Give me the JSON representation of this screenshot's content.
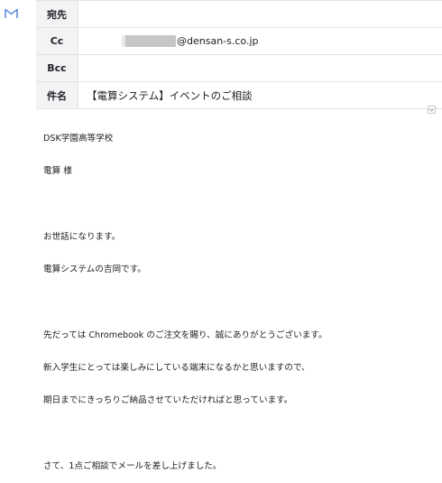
{
  "compose": {
    "to": {
      "label": "宛先",
      "value": ""
    },
    "cc": {
      "label": "Cc",
      "value": "@densan-s.co.jp"
    },
    "bcc": {
      "label": "Bcc",
      "value": ""
    },
    "subject": {
      "label": "件名",
      "value": "【電算システム】イベントのご相談"
    }
  },
  "body": {
    "lines": [
      "DSK学園高等学校",
      "電算 様",
      "",
      "お世話になります。",
      "電算システムの吉岡です。",
      "",
      "先だっては Chromebook のご注文を賜り、誠にありがとうございます。",
      "新入学生にとっては楽しみにしている端末になるかと思いますので、",
      "期日までにきっちりご納品させていただければと思っています。",
      "",
      "さて、1点ご相談でメールを差し上げました。"
    ]
  },
  "icons": {
    "app": "gmail-icon",
    "expand": "chevron-down-icon"
  },
  "colors": {
    "header_bg": "#f1f3f4",
    "border": "#e3e3e3",
    "gmail_blue": "#4a7fd4"
  }
}
